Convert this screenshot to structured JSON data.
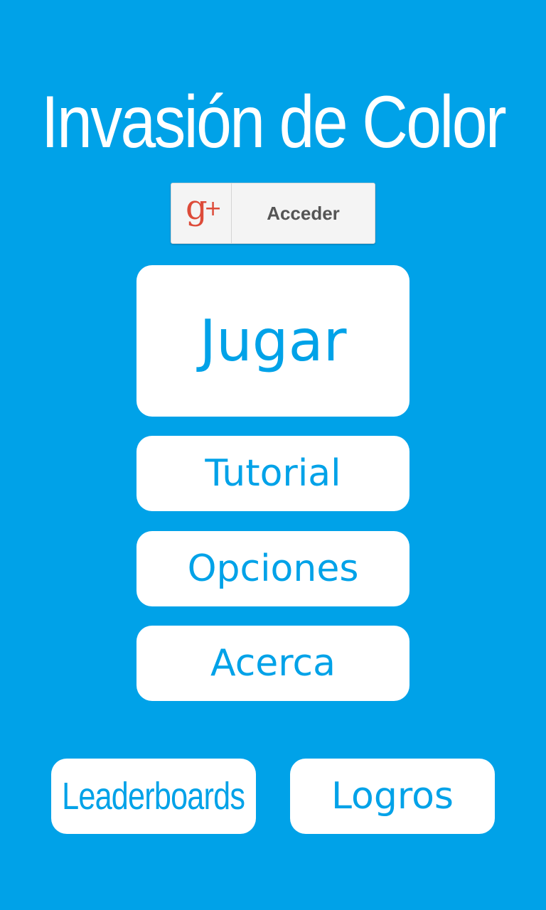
{
  "app": {
    "title": "Invasión de Color"
  },
  "signin": {
    "label": "Acceder",
    "icon": "google-plus-icon",
    "colors": {
      "g": "#dd4b39"
    }
  },
  "menu": {
    "play_label": "Jugar",
    "tutorial_label": "Tutorial",
    "options_label": "Opciones",
    "about_label": "Acerca",
    "leaderboards_label": "Leaderboards",
    "achievements_label": "Logros"
  },
  "colors": {
    "background": "#00a2e8",
    "button": "#ffffff",
    "button_text": "#00a2e8"
  }
}
